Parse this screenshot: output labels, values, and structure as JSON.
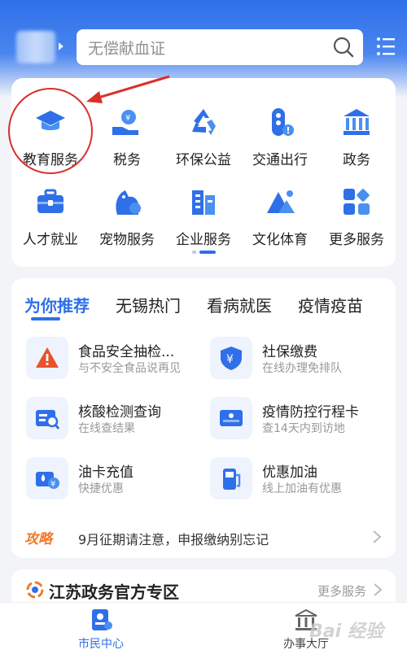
{
  "search": {
    "placeholder": "无偿献血证"
  },
  "services": [
    {
      "label": "教育服务",
      "icon": "graduation-cap-icon"
    },
    {
      "label": "税务",
      "icon": "tax-hand-icon"
    },
    {
      "label": "环保公益",
      "icon": "recycle-icon"
    },
    {
      "label": "交通出行",
      "icon": "traffic-light-icon"
    },
    {
      "label": "政务",
      "icon": "government-building-icon"
    },
    {
      "label": "人才就业",
      "icon": "briefcase-icon"
    },
    {
      "label": "宠物服务",
      "icon": "pet-icon"
    },
    {
      "label": "企业服务",
      "icon": "enterprise-building-icon"
    },
    {
      "label": "文化体育",
      "icon": "mountain-icon"
    },
    {
      "label": "更多服务",
      "icon": "grid-icon"
    }
  ],
  "recommend": {
    "tabs": [
      "为你推荐",
      "无锡热门",
      "看病就医",
      "疫情疫苗"
    ],
    "items": [
      {
        "title": "食品安全抽检...",
        "sub": "与不安全食品说再见",
        "icon": "warning-icon"
      },
      {
        "title": "社保缴费",
        "sub": "在线办理免排队",
        "icon": "yuan-shield-icon"
      },
      {
        "title": "核酸检测查询",
        "sub": "在线查结果",
        "icon": "test-search-icon"
      },
      {
        "title": "疫情防控行程卡",
        "sub": "查14天内到访地",
        "icon": "travel-card-icon"
      },
      {
        "title": "油卡充值",
        "sub": "快捷优惠",
        "icon": "fuel-card-icon"
      },
      {
        "title": "优惠加油",
        "sub": "线上加油有优惠",
        "icon": "gas-pump-icon"
      }
    ],
    "notice_tag": "攻略",
    "notice_text": "9月征期请注意，申报缴纳别忘记"
  },
  "jiangsu": {
    "title": "江苏政务官方专区",
    "more": "更多服务"
  },
  "bottom_nav": {
    "left": "市民中心",
    "right": "办事大厅"
  },
  "watermark": "Bai 经验",
  "colors": {
    "primary": "#2f6fe8",
    "annotation": "#d9302c",
    "orange": "#f07a2a"
  }
}
